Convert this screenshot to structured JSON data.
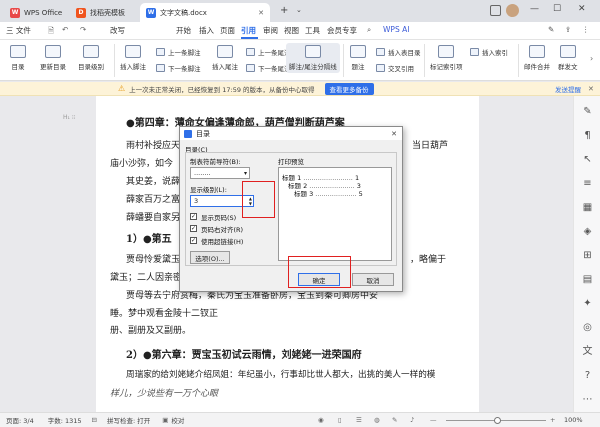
{
  "colors": {
    "accent": "#2f6fe8",
    "wps_red": "#e94848",
    "highlight": "#e02020"
  },
  "tabs": [
    {
      "label": "WPS Office",
      "icon": "wps-logo-icon"
    },
    {
      "label": "找稻壳模板",
      "icon": "docer-icon"
    },
    {
      "label": "文字文稿.docx",
      "icon": "writer-doc-icon"
    }
  ],
  "menubar": {
    "file": "三 文件",
    "edit": "改写",
    "items": [
      "开始",
      "插入",
      "页面",
      "引用",
      "审阅",
      "视图",
      "工具",
      "会员专享"
    ],
    "active": "引用",
    "wps_ai": "WPS AI"
  },
  "ribbon": {
    "toc": "目录",
    "update_toc": "更新目录",
    "toc_level": "目录级别",
    "insert_footnote": "插入脚注",
    "prev_footnote": "上一条脚注",
    "next_footnote": "下一条脚注",
    "insert_endnote": "插入尾注",
    "prev_endnote": "上一条尾注",
    "next_endnote": "下一条尾注",
    "footnote_sep": "脚注/尾注分隔线",
    "insert_caption": "题注",
    "cross_ref": "交叉引用",
    "insert_table_figures": "插入表目录",
    "mark_index": "标记索引项",
    "insert_index": "插入索引",
    "mail_merge": "邮件合并",
    "ai_view": "群发文"
  },
  "notice": {
    "text": "上一次未正常关闭，已经恢复到 17:59 的版本，从备份中心取得",
    "link": "查看更多备份",
    "right_link": "发送提醒"
  },
  "document": {
    "lines": [
      "●第四章：薄命女偏逢薄命郎，葫芦僧判断葫芦案",
      "雨村补授应天",
      "当日葫芦",
      "庙小沙弥，如今",
      "其史姜，说薛",
      "薛家百万之富",
      "薛蟠要自家另",
      "1）●第五",
      "贾母怜爱黛玉",
      "，略偏于",
      "黛玉；二人因亲密",
      "贾母等去宁府赏梅，秦氏为宝玉准备卧房，宝玉到秦可卿房中安",
      "睡。梦中观看金陵十二钗正",
      "册、副册及又副册。",
      "2）●第六章：贾宝玉初试云雨情，刘姥姥一进荣国府",
      "周瑞家的给刘姥姥介绍凤姐：年纪虽小，行事却比世人都大，出挑的美人一样的模",
      "样儿，少说些有一万个心眼"
    ]
  },
  "dialog": {
    "title": "目录",
    "toc_group": "目录(C)",
    "leader_label": "制表符前导符(B):",
    "leader_value": "........",
    "levels_label": "显示级别(L):",
    "levels_value": "3",
    "show_pages": "显示页码(S)",
    "align_right": "页码右对齐(R)",
    "use_links": "使用超链接(H)",
    "options": "选项(O)...",
    "preview_label": "打印预览",
    "preview": [
      {
        "text": "标题 1",
        "page": "1"
      },
      {
        "text": "标题 2",
        "page": "3"
      },
      {
        "text": "标题 3",
        "page": "5"
      }
    ],
    "ok": "确定",
    "cancel": "取消"
  },
  "status": {
    "page": "页面: 3/4",
    "words": "字数: 1315",
    "spell": "拼写检查: 打开",
    "proof": "校对",
    "zoom": "100%"
  }
}
